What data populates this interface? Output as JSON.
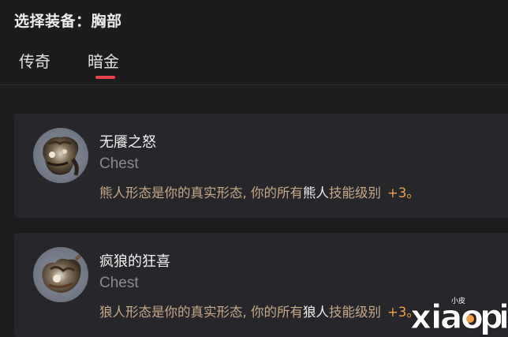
{
  "header": {
    "title": "选择装备：胸部",
    "tabs": [
      {
        "label": "传奇",
        "active": false
      },
      {
        "label": "暗金",
        "active": true
      }
    ]
  },
  "items": [
    {
      "name": "无餍之怒",
      "type": "Chest",
      "desc_before": "熊人形态是你的真实形态, 你的所有",
      "desc_highlight": "熊人",
      "desc_after": "技能级别",
      "desc_bonus": "+3。"
    },
    {
      "name": "疯狼的狂喜",
      "type": "Chest",
      "desc_before": "狼人形态是你的真实形态, 你的所有",
      "desc_highlight": "狼人",
      "desc_after": "技能级别",
      "desc_bonus": "+3。"
    }
  ],
  "watermark": {
    "small_text": "小皮",
    "logo_text": "xiaopi"
  },
  "colors": {
    "accent_underline": "#e8434d",
    "bonus": "#f0a24a",
    "description": "#c9a98a"
  }
}
